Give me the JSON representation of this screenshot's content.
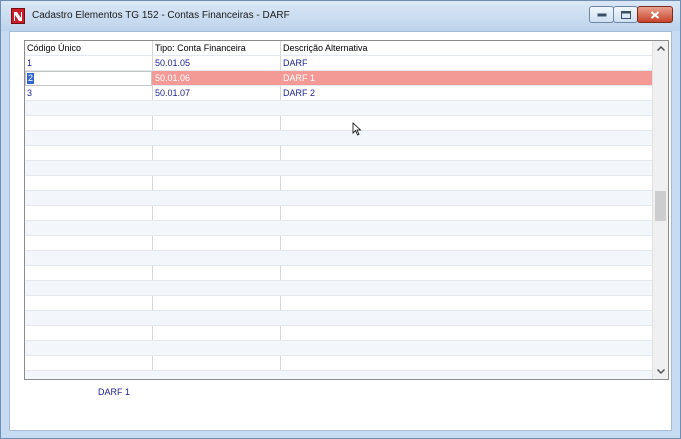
{
  "window": {
    "title": "Cadastro Elementos TG 152 - Contas Financeiras - DARF",
    "icon": "app-logo-icon",
    "controls": [
      "minimize-icon",
      "maximize-icon",
      "close-icon"
    ]
  },
  "grid": {
    "columns": [
      "Código Único",
      "Tipo: Conta Financeira",
      "Descrição Alternativa"
    ],
    "rows": [
      {
        "codigo": "1",
        "tipo": "50.01.05",
        "descricao": "DARF"
      },
      {
        "codigo": "2",
        "tipo": "50.01.06",
        "descricao": "DARF 1",
        "selected": true
      },
      {
        "codigo": "3",
        "tipo": "50.01.07",
        "descricao": "DARF 2"
      }
    ],
    "selected_row_color": "#f39a96",
    "text_color": "#1a1f8c"
  },
  "footer": {
    "selected_description": "DARF 1"
  }
}
